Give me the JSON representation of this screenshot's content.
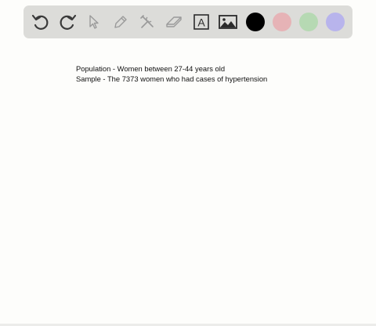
{
  "toolbar": {
    "tools": [
      {
        "name": "undo-icon"
      },
      {
        "name": "redo-icon"
      },
      {
        "name": "select-icon"
      },
      {
        "name": "pencil-icon"
      },
      {
        "name": "tools-icon"
      },
      {
        "name": "eraser-icon"
      },
      {
        "name": "text-tool-icon",
        "glyph": "A"
      },
      {
        "name": "image-icon"
      }
    ],
    "colors": {
      "black": "#000000",
      "red": "#e6b3b6",
      "green": "#b6d9b3",
      "blue": "#b8b4ec"
    }
  },
  "canvas": {
    "lines": [
      "Population - Women between 27-44 years old",
      "Sample - The 7373 women who had cases of hypertension"
    ]
  }
}
